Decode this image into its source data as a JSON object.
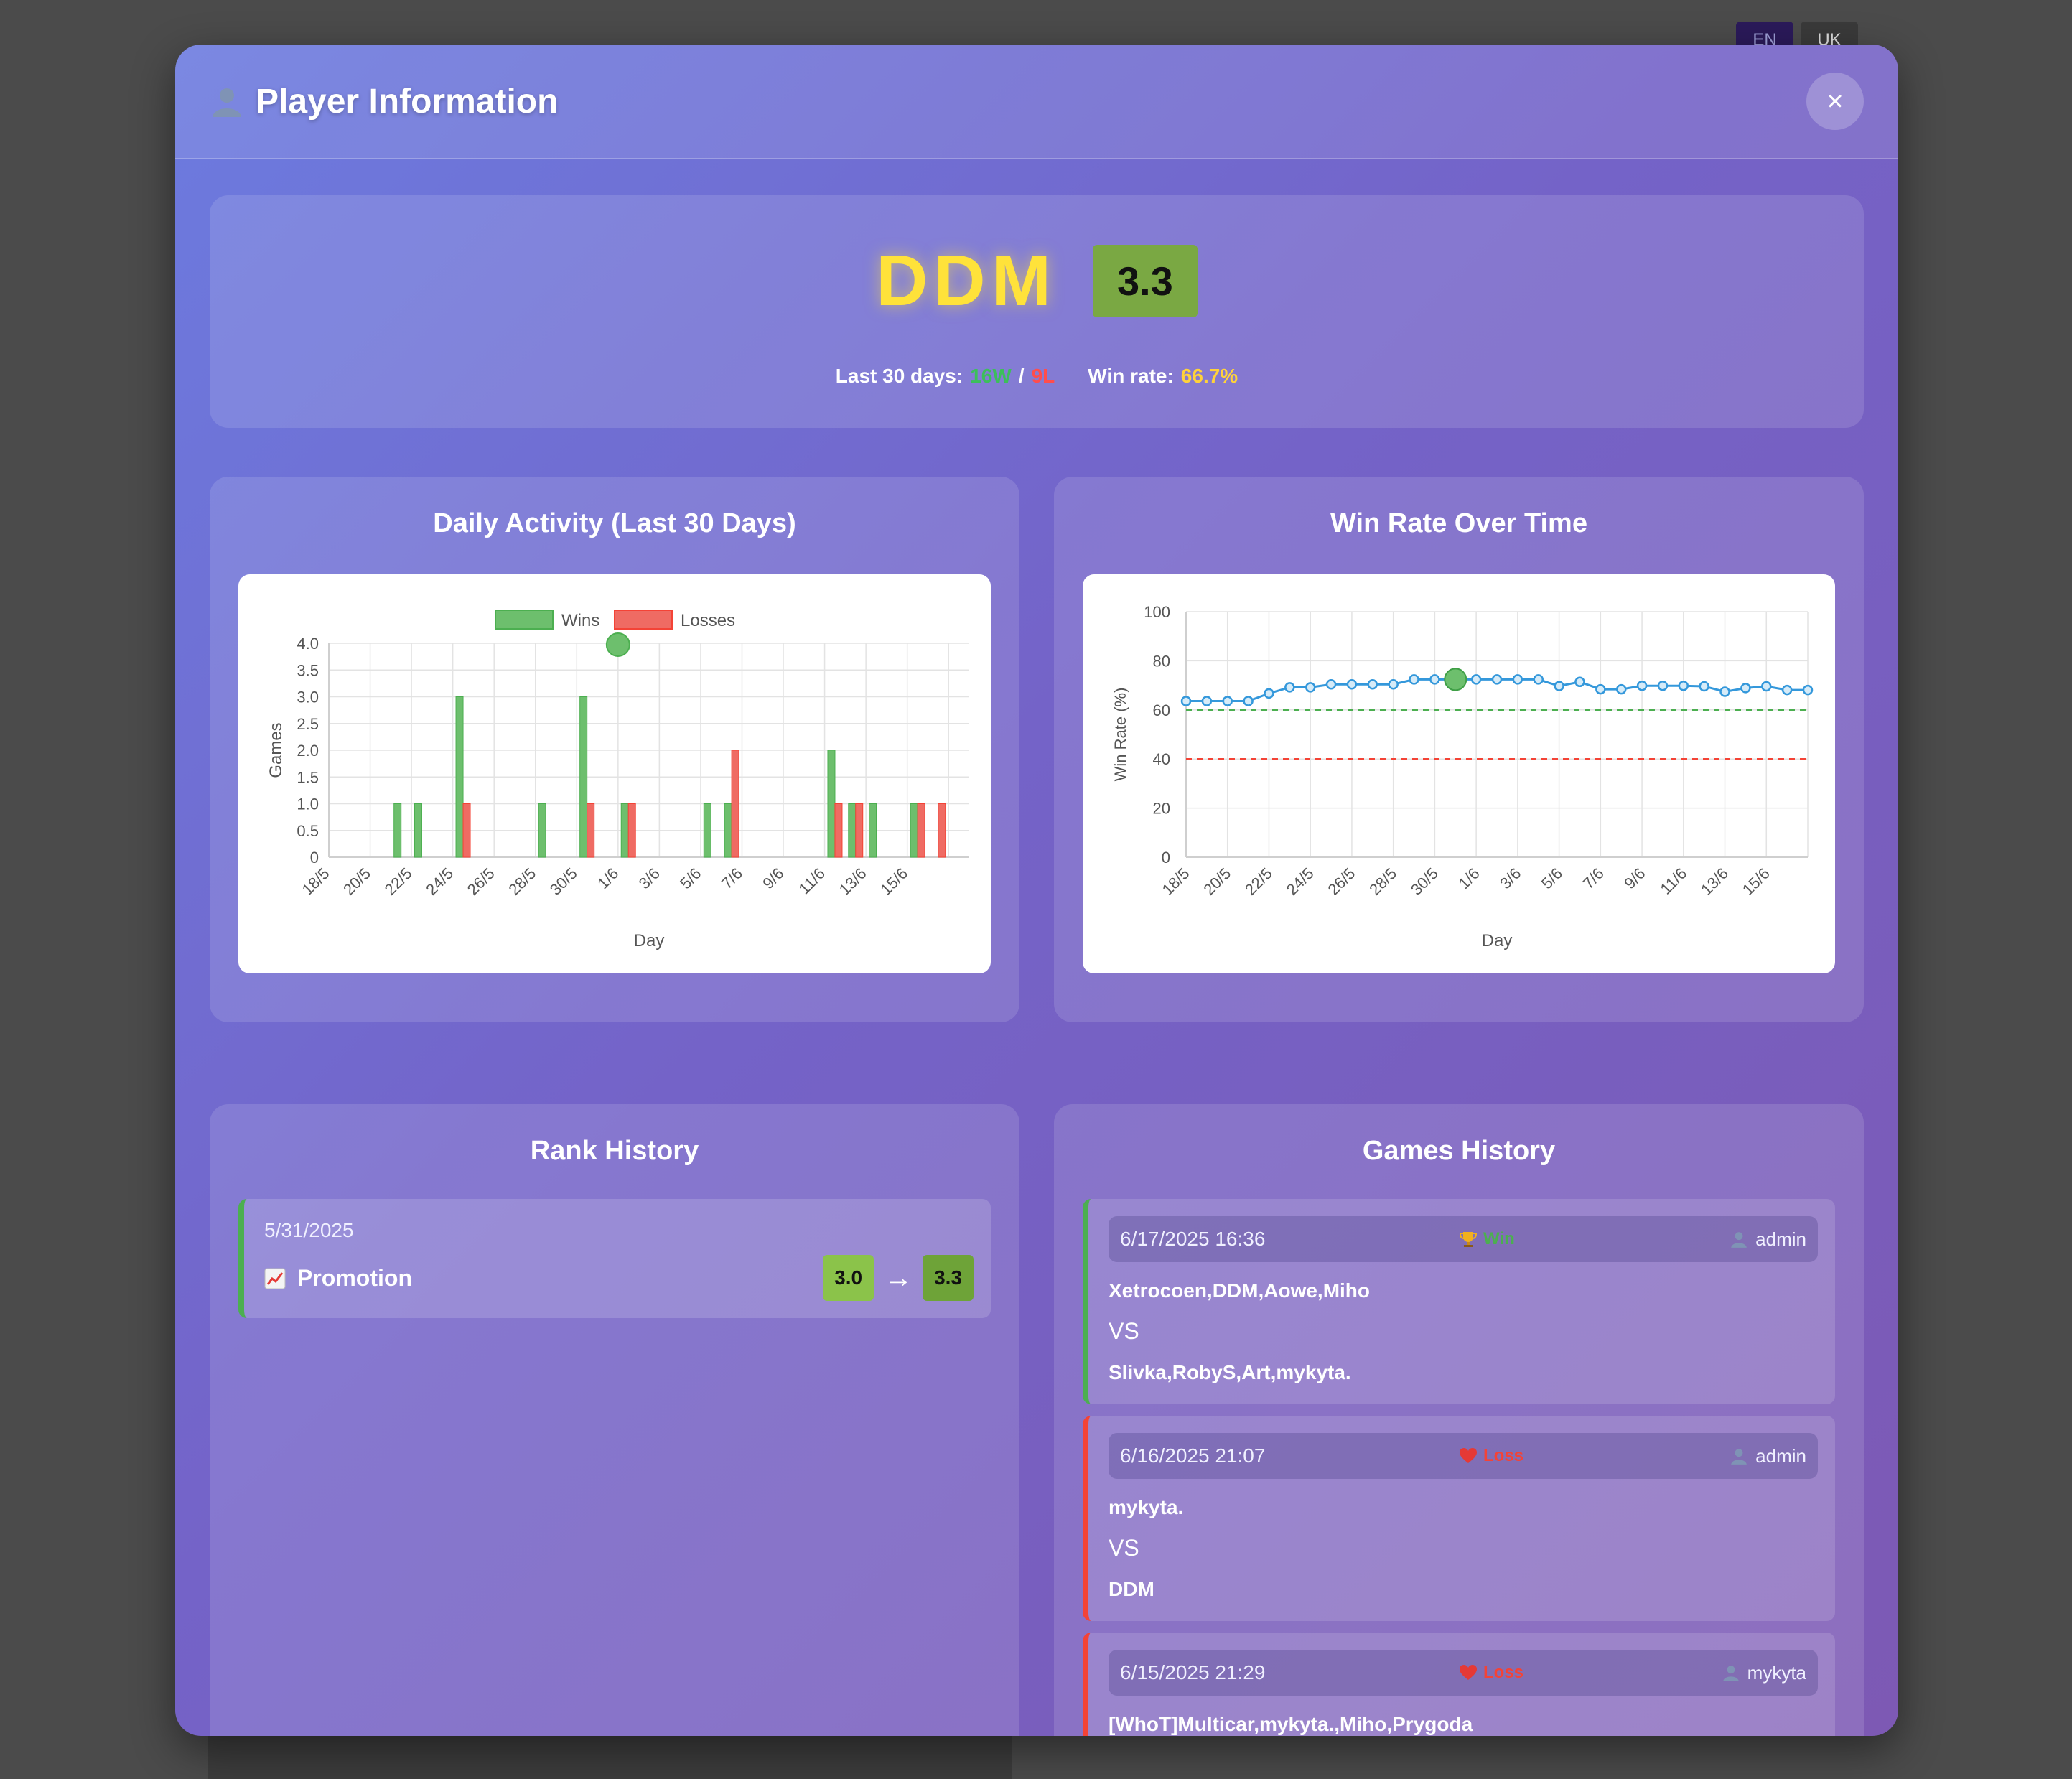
{
  "lang": {
    "en": "EN",
    "uk": "UK"
  },
  "modal": {
    "title": "Player Information",
    "close": "×"
  },
  "player": {
    "name": "DDM",
    "rank": "3.3",
    "last30_label": "Last 30 days:",
    "wins": "16W",
    "separator": "/",
    "losses": "9L",
    "winrate_label": "Win rate:",
    "winrate": "66.7%"
  },
  "sections": {
    "daily": "Daily Activity (Last 30 Days)",
    "winrate": "Win Rate Over Time",
    "rank_history": "Rank History",
    "games_history": "Games History"
  },
  "colors": {
    "win": "#4caf50",
    "loss": "#f44336",
    "line": "#3498db",
    "accent": "#ffe23a"
  },
  "chart_data": [
    {
      "type": "bar",
      "title": "",
      "xlabel": "Day",
      "ylabel": "Games",
      "ylim": [
        0,
        4
      ],
      "yticks": [
        "0",
        "0.5",
        "1.0",
        "1.5",
        "2.0",
        "2.5",
        "3.0",
        "3.5",
        "4.0"
      ],
      "legend": "top",
      "grid": true,
      "categories": [
        "18/5",
        "19/5",
        "20/5",
        "21/5",
        "22/5",
        "23/5",
        "24/5",
        "25/5",
        "26/5",
        "27/5",
        "28/5",
        "29/5",
        "30/5",
        "31/5",
        "1/6",
        "2/6",
        "3/6",
        "4/6",
        "5/6",
        "6/6",
        "7/6",
        "8/6",
        "9/6",
        "10/6",
        "11/6",
        "12/6",
        "13/6",
        "14/6",
        "15/6",
        "16/6",
        "17/6"
      ],
      "tick_labels": [
        "18/5",
        "20/5",
        "22/5",
        "24/5",
        "26/5",
        "28/5",
        "30/5",
        "1/6",
        "3/6",
        "5/6",
        "7/6",
        "9/6",
        "11/6",
        "13/6",
        "15/6"
      ],
      "series": [
        {
          "name": "Wins",
          "color": "#6dbf6d",
          "values": [
            0,
            0,
            0,
            1,
            1,
            0,
            3,
            0,
            0,
            0,
            1,
            0,
            3,
            0,
            1,
            0,
            0,
            0,
            1,
            1,
            0,
            0,
            0,
            0,
            2,
            1,
            1,
            0,
            1,
            0,
            0
          ]
        },
        {
          "name": "Losses",
          "color": "#ef6b63",
          "values": [
            0,
            0,
            0,
            0,
            0,
            0,
            1,
            0,
            0,
            0,
            0,
            0,
            1,
            0,
            1,
            0,
            0,
            0,
            0,
            2,
            0,
            0,
            0,
            0,
            1,
            1,
            0,
            0,
            1,
            1,
            0
          ]
        }
      ]
    },
    {
      "type": "line",
      "title": "",
      "xlabel": "Day",
      "ylabel": "Win Rate (%)",
      "ylim": [
        0,
        100
      ],
      "yticks": [
        "0",
        "20",
        "40",
        "60",
        "80",
        "100"
      ],
      "grid": true,
      "tick_labels": [
        "18/5",
        "20/5",
        "22/5",
        "24/5",
        "26/5",
        "28/5",
        "30/5",
        "1/6",
        "3/6",
        "5/6",
        "7/6",
        "9/6",
        "11/6",
        "13/6",
        "15/6"
      ],
      "x": [
        "18/5",
        "19/5",
        "20/5",
        "21/5",
        "22/5",
        "23/5",
        "24/5",
        "25/5",
        "26/5",
        "27/5",
        "28/5",
        "29/5",
        "30/5",
        "31/5",
        "1/6",
        "2/6",
        "3/6",
        "4/6",
        "5/6",
        "6/6",
        "7/6",
        "8/6",
        "9/6",
        "10/6",
        "11/6",
        "12/6",
        "13/6",
        "14/6",
        "15/6",
        "16/6",
        "17/6"
      ],
      "values": [
        63.6,
        63.6,
        63.6,
        63.6,
        66.7,
        69.2,
        69.2,
        70.4,
        70.4,
        70.4,
        70.4,
        72.4,
        72.4,
        72.4,
        72.4,
        72.4,
        72.4,
        72.4,
        69.7,
        71.4,
        68.4,
        68.4,
        69.8,
        69.8,
        69.8,
        69.6,
        67.4,
        68.9,
        69.6,
        68.1,
        68.1
      ],
      "highlight_index": 13,
      "reference_lines": [
        {
          "value": 60,
          "color": "#4caf50"
        },
        {
          "value": 40,
          "color": "#f44336"
        }
      ]
    }
  ],
  "rank_history": [
    {
      "date": "5/31/2025",
      "change": "Promotion",
      "icon": "chart-up-icon",
      "from": "3.0",
      "to": "3.3"
    }
  ],
  "games": [
    {
      "date": "6/17/2025 16:36",
      "result": "Win",
      "result_icon": "trophy-icon",
      "author": "admin",
      "team1": "Xetrocoen,DDM,Aowe,Miho",
      "vs": "VS",
      "team2": "Slivka,RobyS,Art,mykyta."
    },
    {
      "date": "6/16/2025 21:07",
      "result": "Loss",
      "result_icon": "heart-icon",
      "author": "admin",
      "team1": "mykyta.",
      "vs": "VS",
      "team2": "DDM"
    },
    {
      "date": "6/15/2025 21:29",
      "result": "Loss",
      "result_icon": "heart-icon",
      "author": "mykyta",
      "team1": "[WhoT]Multicar,mykyta.,Miho,Prygoda"
    }
  ]
}
